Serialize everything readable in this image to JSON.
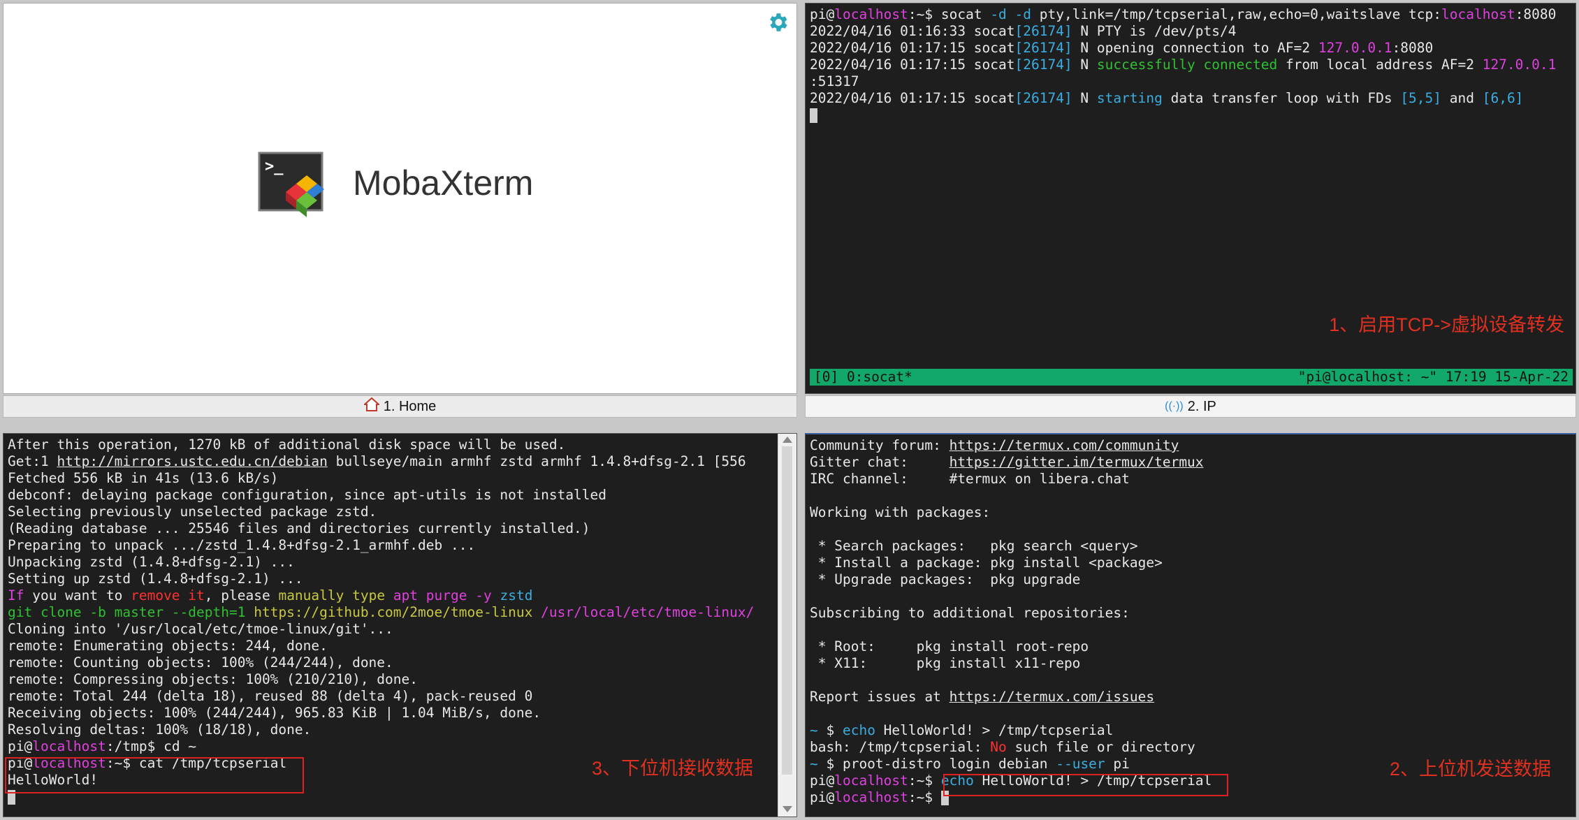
{
  "home": {
    "app_name": "MobaXterm",
    "tab_label": "1. Home"
  },
  "top_right": {
    "tab_label": "2. IP",
    "lines": [
      [
        {
          "t": "pi",
          "c": "gray"
        },
        {
          "t": "@",
          "c": "gray"
        },
        {
          "t": "localhost",
          "c": "pink"
        },
        {
          "t": ":~$ socat ",
          "c": "gray"
        },
        {
          "t": "-d -d",
          "c": "cyan"
        },
        {
          "t": " pty,link=/tmp/tcpserial,raw,echo=0,waitslave tcp:",
          "c": "gray"
        },
        {
          "t": "localhost",
          "c": "pink"
        },
        {
          "t": ":8080",
          "c": "gray"
        }
      ],
      [
        {
          "t": "2022/04/16 01:16:33 socat",
          "c": "gray"
        },
        {
          "t": "[26174]",
          "c": "cyan"
        },
        {
          "t": " N PTY is /dev/pts/4",
          "c": "gray"
        }
      ],
      [
        {
          "t": "2022/04/16 01:17:15 socat",
          "c": "gray"
        },
        {
          "t": "[26174]",
          "c": "cyan"
        },
        {
          "t": " N opening connection to AF=2 ",
          "c": "gray"
        },
        {
          "t": "127.0.0.1",
          "c": "pink"
        },
        {
          "t": ":8080",
          "c": "gray"
        }
      ],
      [
        {
          "t": "2022/04/16 01:17:15 socat",
          "c": "gray"
        },
        {
          "t": "[26174]",
          "c": "cyan"
        },
        {
          "t": " N ",
          "c": "gray"
        },
        {
          "t": "successfully connected",
          "c": "green"
        },
        {
          "t": " from local address AF=2 ",
          "c": "gray"
        },
        {
          "t": "127.0.0.1",
          "c": "pink"
        }
      ],
      [
        {
          "t": ":51317",
          "c": "gray"
        }
      ],
      [
        {
          "t": "2022/04/16 01:17:15 socat",
          "c": "gray"
        },
        {
          "t": "[26174]",
          "c": "cyan"
        },
        {
          "t": " N ",
          "c": "gray"
        },
        {
          "t": "starting",
          "c": "cyan"
        },
        {
          "t": " data transfer loop with FDs ",
          "c": "gray"
        },
        {
          "t": "[5,5]",
          "c": "cyan"
        },
        {
          "t": " and ",
          "c": "gray"
        },
        {
          "t": "[6,6]",
          "c": "cyan"
        }
      ]
    ],
    "status_left": "[0] 0:socat*",
    "status_right": "\"pi@localhost: ~\" 17:19 15-Apr-22",
    "annotation": "1、启用TCP->虚拟设备转发"
  },
  "bottom_left": {
    "lines": [
      [
        {
          "t": "After this operation, 1270 kB of additional disk space will be used.",
          "c": "gray"
        }
      ],
      [
        {
          "t": "Get:1 ",
          "c": "gray"
        },
        {
          "t": "http://mirrors.ustc.edu.cn/debian",
          "c": "gray",
          "u": true
        },
        {
          "t": " bullseye/main armhf zstd armhf 1.4.8+dfsg-2.1 [556",
          "c": "gray"
        }
      ],
      [
        {
          "t": "Fetched 556 kB in 41s (13.6 kB/s)",
          "c": "gray"
        }
      ],
      [
        {
          "t": "debconf: delaying package configuration, since apt-utils is not installed",
          "c": "gray"
        }
      ],
      [
        {
          "t": "Selecting previously unselected package zstd.",
          "c": "gray"
        }
      ],
      [
        {
          "t": "(Reading database ... 25546 files and directories currently installed.)",
          "c": "gray"
        }
      ],
      [
        {
          "t": "Preparing to unpack .../zstd_1.4.8+dfsg-2.1_armhf.deb ...",
          "c": "gray"
        }
      ],
      [
        {
          "t": "Unpacking zstd (1.4.8+dfsg-2.1) ...",
          "c": "gray"
        }
      ],
      [
        {
          "t": "Setting up zstd (1.4.8+dfsg-2.1) ...",
          "c": "gray"
        }
      ],
      [
        {
          "t": "If",
          "c": "pink"
        },
        {
          "t": " you want to ",
          "c": "gray"
        },
        {
          "t": "remove it",
          "c": "red"
        },
        {
          "t": ", please ",
          "c": "gray"
        },
        {
          "t": "manually type",
          "c": "yellow"
        },
        {
          "t": " ",
          "c": "gray"
        },
        {
          "t": "apt purge -y",
          "c": "pink"
        },
        {
          "t": " ",
          "c": "gray"
        },
        {
          "t": "zstd",
          "c": "cyan"
        }
      ],
      [
        {
          "t": "git clone -b master --depth=1",
          "c": "green"
        },
        {
          "t": " ",
          "c": "gray"
        },
        {
          "t": "https://github.com/2moe/tmoe-linux",
          "c": "yellow"
        },
        {
          "t": " ",
          "c": "gray"
        },
        {
          "t": "/usr/local/etc/tmoe-linux/",
          "c": "pink"
        }
      ],
      [
        {
          "t": "Cloning into '/usr/local/etc/tmoe-linux/git'...",
          "c": "gray"
        }
      ],
      [
        {
          "t": "remote: Enumerating objects: 244, done.",
          "c": "gray"
        }
      ],
      [
        {
          "t": "remote: Counting objects: 100% (244/244), done.",
          "c": "gray"
        }
      ],
      [
        {
          "t": "remote: Compressing objects: 100% (210/210), done.",
          "c": "gray"
        }
      ],
      [
        {
          "t": "remote: Total 244 (delta 18), reused 88 (delta 4), pack-reused 0",
          "c": "gray"
        }
      ],
      [
        {
          "t": "Receiving objects: 100% (244/244), 965.83 KiB | 1.04 MiB/s, done.",
          "c": "gray"
        }
      ],
      [
        {
          "t": "Resolving deltas: 100% (18/18), done.",
          "c": "gray"
        }
      ],
      [
        {
          "t": "pi@",
          "c": "gray"
        },
        {
          "t": "localhost",
          "c": "pink"
        },
        {
          "t": ":/tmp$ cd ~",
          "c": "gray"
        }
      ],
      [
        {
          "t": "pi@",
          "c": "gray"
        },
        {
          "t": "localhost",
          "c": "pink"
        },
        {
          "t": ":~$ cat /tmp/tcpserial",
          "c": "gray"
        }
      ],
      [
        {
          "t": "HelloWorld!",
          "c": "gray"
        }
      ]
    ],
    "annotation": "3、下位机接收数据"
  },
  "bottom_right": {
    "lines": [
      [
        {
          "t": "Community forum: ",
          "c": "gray"
        },
        {
          "t": "https://termux.com/community",
          "c": "gray",
          "u": true
        }
      ],
      [
        {
          "t": "Gitter chat:     ",
          "c": "gray"
        },
        {
          "t": "https://gitter.im/termux/termux",
          "c": "gray",
          "u": true
        }
      ],
      [
        {
          "t": "IRC channel:     #termux on libera.chat",
          "c": "gray"
        }
      ],
      [
        {
          "t": "",
          "c": "gray"
        }
      ],
      [
        {
          "t": "Working with packages:",
          "c": "gray"
        }
      ],
      [
        {
          "t": "",
          "c": "gray"
        }
      ],
      [
        {
          "t": " * Search packages:   pkg search <query>",
          "c": "gray"
        }
      ],
      [
        {
          "t": " * Install a package: pkg install <package>",
          "c": "gray"
        }
      ],
      [
        {
          "t": " * Upgrade packages:  pkg upgrade",
          "c": "gray"
        }
      ],
      [
        {
          "t": "",
          "c": "gray"
        }
      ],
      [
        {
          "t": "Subscribing to additional repositories:",
          "c": "gray"
        }
      ],
      [
        {
          "t": "",
          "c": "gray"
        }
      ],
      [
        {
          "t": " * Root:     pkg install root-repo",
          "c": "gray"
        }
      ],
      [
        {
          "t": " * X11:      pkg install x11-repo",
          "c": "gray"
        }
      ],
      [
        {
          "t": "",
          "c": "gray"
        }
      ],
      [
        {
          "t": "Report issues at ",
          "c": "gray"
        },
        {
          "t": "https://termux.com/issues",
          "c": "gray",
          "u": true
        }
      ],
      [
        {
          "t": "",
          "c": "gray"
        }
      ],
      [
        {
          "t": "~ ",
          "c": "cyan"
        },
        {
          "t": "$ ",
          "c": "gray"
        },
        {
          "t": "echo",
          "c": "cyan"
        },
        {
          "t": " HelloWorld! > /tmp/tcpserial",
          "c": "gray"
        }
      ],
      [
        {
          "t": "bash: /tmp/tcpserial: ",
          "c": "gray"
        },
        {
          "t": "No",
          "c": "red"
        },
        {
          "t": " such file or directory",
          "c": "gray"
        }
      ],
      [
        {
          "t": "~ ",
          "c": "cyan"
        },
        {
          "t": "$ proot-distro login debian ",
          "c": "gray"
        },
        {
          "t": "--user",
          "c": "cyan"
        },
        {
          "t": " pi",
          "c": "gray"
        }
      ],
      [
        {
          "t": "pi@",
          "c": "gray"
        },
        {
          "t": "localhost",
          "c": "pink"
        },
        {
          "t": ":~$ ",
          "c": "gray"
        },
        {
          "t": "echo",
          "c": "cyan"
        },
        {
          "t": " HelloWorld! > /tmp/tcpserial",
          "c": "gray"
        }
      ],
      [
        {
          "t": "pi@",
          "c": "gray"
        },
        {
          "t": "localhost",
          "c": "pink"
        },
        {
          "t": ":~$ ",
          "c": "gray"
        }
      ]
    ],
    "annotation": "2、上位机发送数据"
  }
}
